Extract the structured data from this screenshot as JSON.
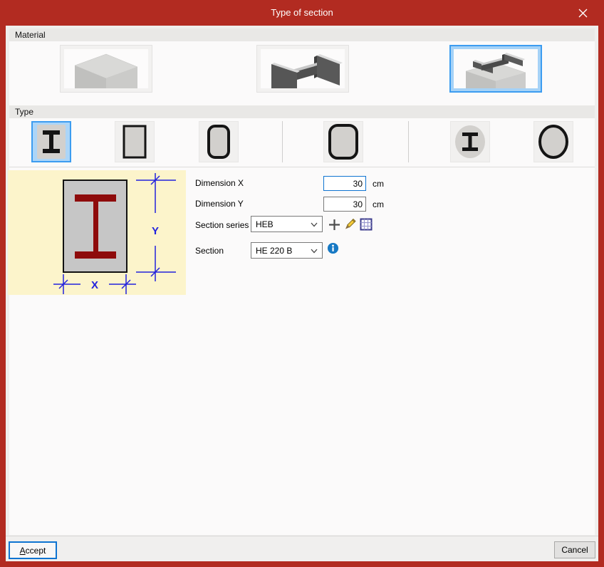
{
  "window": {
    "title": "Type of section",
    "close_glyph": "✕"
  },
  "material": {
    "header": "Material",
    "options": [
      {
        "name": "concrete-column",
        "selected": false
      },
      {
        "name": "steel-section",
        "selected": false
      },
      {
        "name": "composite-steel-on-concrete",
        "selected": true
      }
    ]
  },
  "type": {
    "header": "Type",
    "options": [
      {
        "name": "i-section",
        "selected": true
      },
      {
        "name": "rectangular",
        "selected": false
      },
      {
        "name": "rounded-rectangular",
        "selected": false
      },
      {
        "name": "rounded-square",
        "selected": false
      },
      {
        "name": "circular-with-i-section",
        "selected": false
      },
      {
        "name": "circular",
        "selected": false
      }
    ]
  },
  "diagram": {
    "x_label": "X",
    "y_label": "Y"
  },
  "fields": {
    "dimension_x": {
      "label": "Dimension X",
      "value": "30",
      "unit": "cm"
    },
    "dimension_y": {
      "label": "Dimension Y",
      "value": "30",
      "unit": "cm"
    },
    "section_series": {
      "label": "Section series",
      "value": "HEB"
    },
    "section": {
      "label": "Section",
      "value": "HE 220 B"
    }
  },
  "icons": {
    "add": "plus-icon",
    "edit": "pencil-icon",
    "catalog": "grid-icon",
    "info": "info-icon"
  },
  "footer": {
    "accept_initial": "A",
    "accept_rest": "ccept",
    "cancel": "Cancel"
  },
  "colors": {
    "titlebar_red": "#b22b21",
    "selection_border_blue": "#3c9cf0",
    "selection_bg_blue": "#abd5f8",
    "focus_blue": "#0f74d1",
    "dimension_blue": "#2222dd",
    "ibeam_maroon": "#8e0b0b",
    "panel_yellow": "#fcf4cb"
  }
}
